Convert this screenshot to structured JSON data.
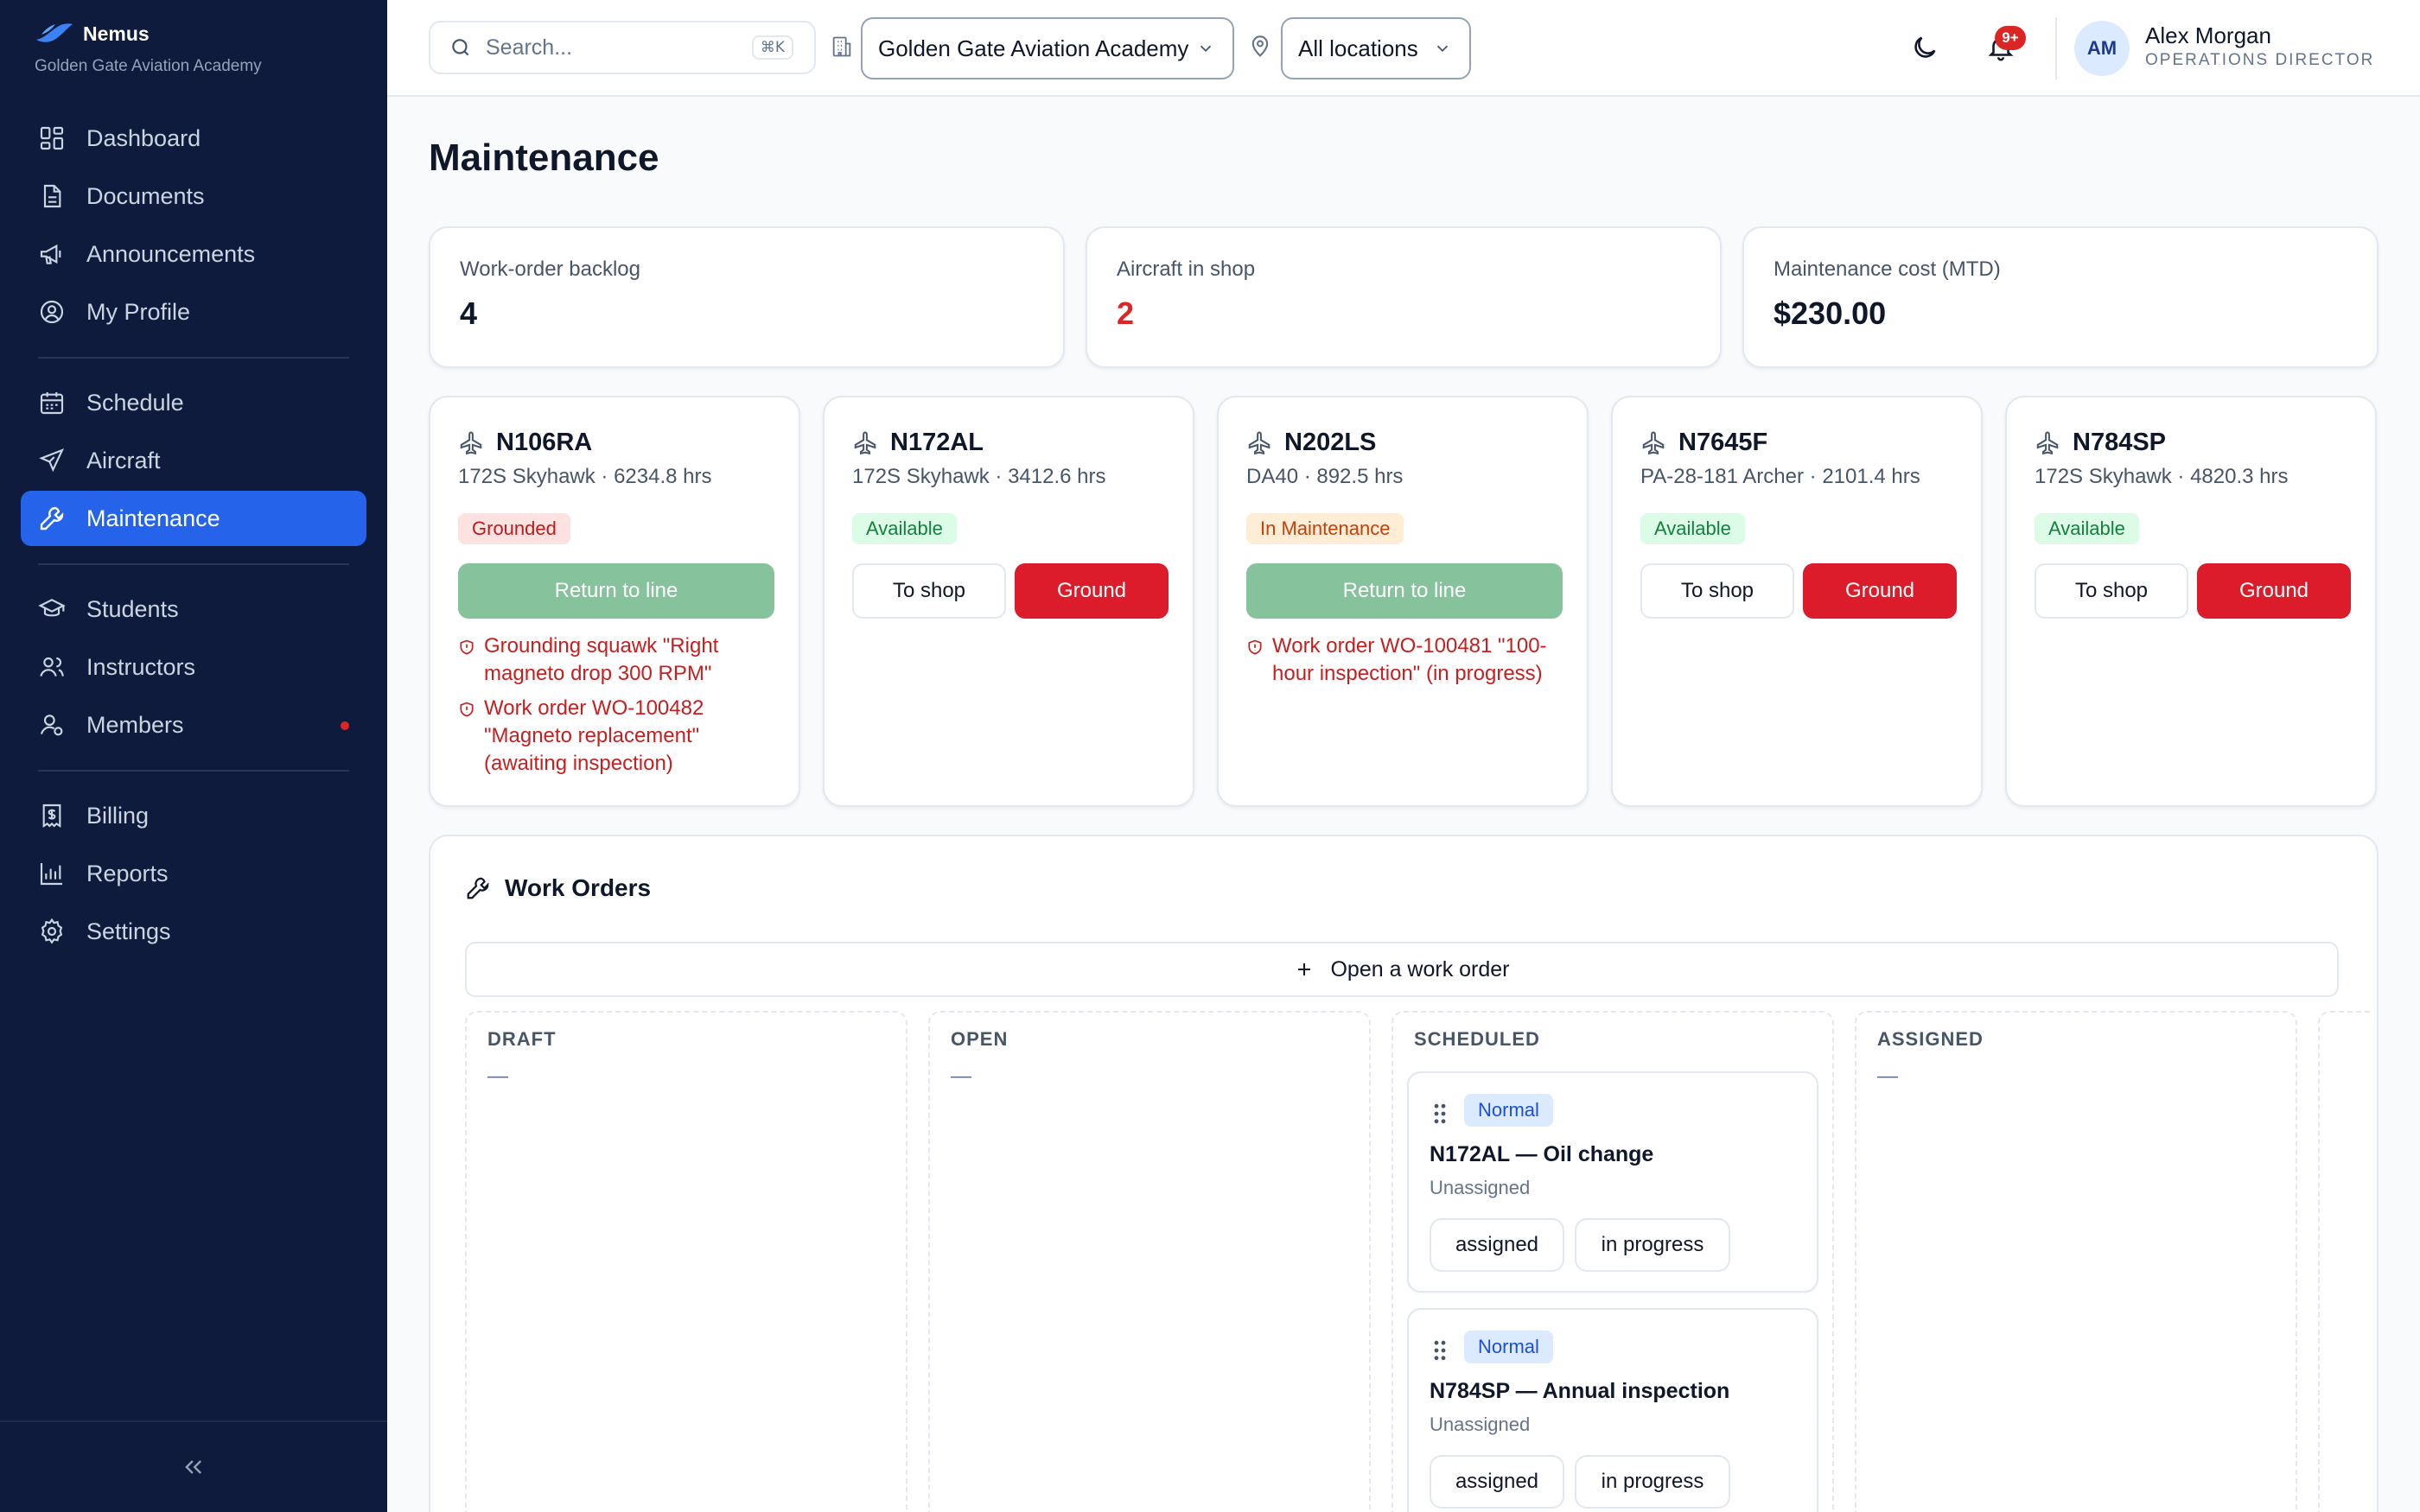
{
  "brand": {
    "name": "Nemus",
    "org": "Golden Gate Aviation Academy"
  },
  "nav": {
    "group1": [
      {
        "label": "Dashboard",
        "icon": "dashboard-icon"
      },
      {
        "label": "Documents",
        "icon": "document-icon"
      },
      {
        "label": "Announcements",
        "icon": "megaphone-icon"
      },
      {
        "label": "My Profile",
        "icon": "profile-icon"
      }
    ],
    "group2": [
      {
        "label": "Schedule",
        "icon": "calendar-icon"
      },
      {
        "label": "Aircraft",
        "icon": "plane-icon"
      },
      {
        "label": "Maintenance",
        "icon": "wrench-icon",
        "active": true
      }
    ],
    "group3": [
      {
        "label": "Students",
        "icon": "graduation-cap-icon"
      },
      {
        "label": "Instructors",
        "icon": "users-icon"
      },
      {
        "label": "Members",
        "icon": "member-icon"
      }
    ],
    "group4": [
      {
        "label": "Billing",
        "icon": "receipt-icon"
      },
      {
        "label": "Reports",
        "icon": "bar-chart-icon"
      },
      {
        "label": "Settings",
        "icon": "gear-icon"
      }
    ]
  },
  "header": {
    "search_placeholder": "Search...",
    "search_shortcut": "⌘K",
    "organization": "Golden Gate Aviation Academy",
    "location": "All locations",
    "notifications_badge": "9+",
    "user": {
      "initials": "AM",
      "name": "Alex Morgan",
      "role": "OPERATIONS DIRECTOR"
    }
  },
  "page": {
    "title": "Maintenance"
  },
  "stats": [
    {
      "label": "Work-order backlog",
      "value": "4"
    },
    {
      "label": "Aircraft in shop",
      "value": "2",
      "color": "#dc2626"
    },
    {
      "label": "Maintenance cost (MTD)",
      "value": "$230.00"
    }
  ],
  "aircraft": [
    {
      "tail": "N106RA",
      "meta": "172S Skyhawk · 6234.8 hrs",
      "status": "Grounded",
      "action": "Return to line",
      "reasons": [
        "Grounding squawk \"Right magneto drop 300 RPM\"",
        "Work order WO-100482 \"Magneto replacement\" (awaiting inspection)"
      ]
    },
    {
      "tail": "N172AL",
      "meta": "172S Skyhawk · 3412.6 hrs",
      "status": "Available",
      "shop_label": "To shop",
      "ground_label": "Ground"
    },
    {
      "tail": "N202LS",
      "meta": "DA40 · 892.5 hrs",
      "status": "In Maintenance",
      "action": "Return to line",
      "reasons": [
        "Work order WO-100481 \"100-hour inspection\" (in progress)"
      ]
    },
    {
      "tail": "N7645F",
      "meta": "PA-28-181 Archer · 2101.4 hrs",
      "status": "Available",
      "shop_label": "To shop",
      "ground_label": "Ground"
    },
    {
      "tail": "N784SP",
      "meta": "172S Skyhawk · 4820.3 hrs",
      "status": "Available",
      "shop_label": "To shop",
      "ground_label": "Ground"
    }
  ],
  "work_orders": {
    "title": "Work Orders",
    "open_button": "Open a work order",
    "columns": [
      {
        "title": "DRAFT",
        "empty": "—"
      },
      {
        "title": "OPEN",
        "empty": "—"
      },
      {
        "title": "SCHEDULED",
        "cards": [
          {
            "priority": "Normal",
            "title": "N172AL — Oil change",
            "assignee": "Unassigned",
            "actions": [
              "assigned",
              "in progress"
            ]
          },
          {
            "priority": "Normal",
            "title": "N784SP — Annual inspection",
            "assignee": "Unassigned",
            "actions": [
              "assigned",
              "in progress"
            ]
          }
        ]
      },
      {
        "title": "ASSIGNED",
        "empty": "—"
      },
      {
        "title": "",
        "empty": ""
      }
    ]
  },
  "colors": {
    "sidebar": "#0f1b3d",
    "accent": "#2563eb",
    "danger": "#dc1c2a",
    "success": "#86c29c"
  }
}
